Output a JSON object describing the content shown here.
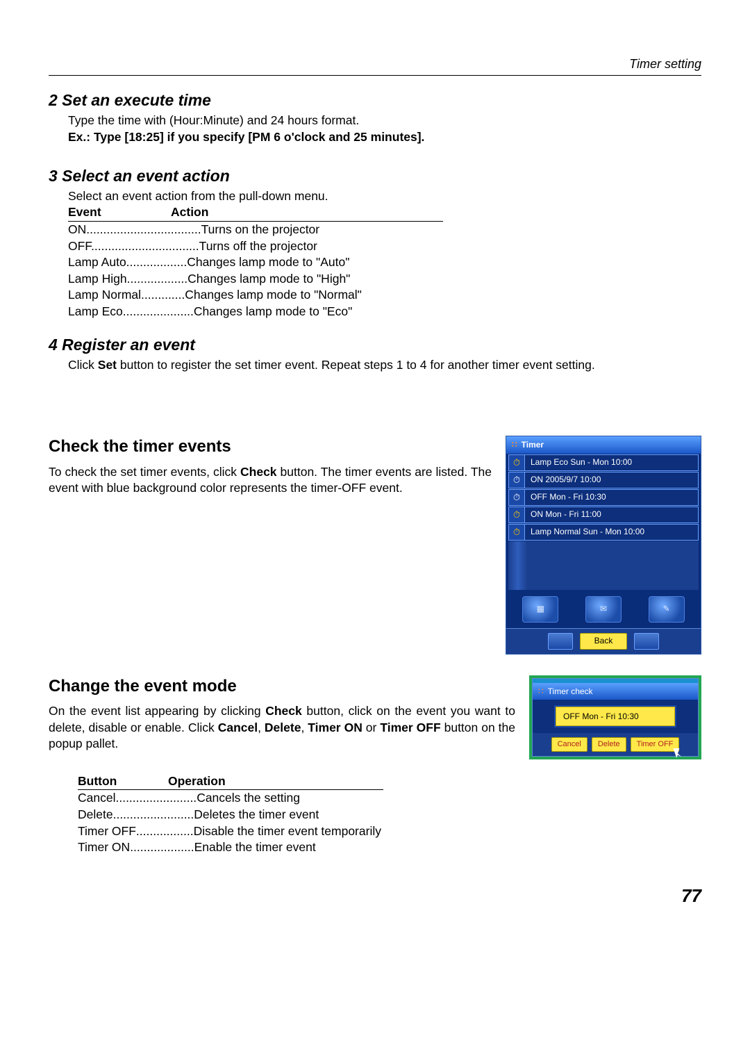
{
  "header": {
    "section": "Timer setting"
  },
  "step2": {
    "title": "2 Set an execute time",
    "line1": "Type the time with (Hour:Minute) and 24 hours format.",
    "line2": "Ex.: Type [18:25] if you specify [PM 6 o'clock and 25 minutes]."
  },
  "step3": {
    "title": "3 Select an event action",
    "intro": "Select an event action from the pull-down menu.",
    "col1": "Event",
    "col2": "Action",
    "rows": [
      {
        "ev": "ON",
        "dots": "..................................",
        "ac": "Turns on the projector"
      },
      {
        "ev": "OFF",
        "dots": "................................",
        "ac": "Turns off the projector"
      },
      {
        "ev": "Lamp Auto",
        "dots": "..................",
        "ac": "Changes lamp mode to \"Auto\""
      },
      {
        "ev": "Lamp High",
        "dots": "..................",
        "ac": "Changes lamp mode to \"High\""
      },
      {
        "ev": "Lamp Normal",
        "dots": ".............",
        "ac": "Changes lamp mode to \"Normal\""
      },
      {
        "ev": "Lamp Eco",
        "dots": ".....................",
        "ac": "Changes lamp mode to \"Eco\""
      }
    ]
  },
  "step4": {
    "title": "4 Register an event",
    "text_a": "Click ",
    "text_b": "Set",
    "text_c": " button to register the set timer event. Repeat steps 1 to 4 for another timer event setting."
  },
  "check": {
    "heading": "Check the timer events",
    "p_a": "To check the set timer events, click ",
    "p_b": "Check",
    "p_c": " button. The timer events are listed. The event with blue background color represents the timer-OFF event."
  },
  "timer_panel": {
    "title": "Timer",
    "rows": [
      {
        "icon": "⏱",
        "yellow": true,
        "text": "Lamp Eco Sun - Mon 10:00"
      },
      {
        "icon": "⏱",
        "yellow": false,
        "text": "ON 2005/9/7 10:00"
      },
      {
        "icon": "⏱",
        "yellow": false,
        "text": "OFF Mon - Fri 10:30"
      },
      {
        "icon": "⏱",
        "yellow": true,
        "text": "ON Mon - Fri 11:00"
      },
      {
        "icon": "⏱",
        "yellow": true,
        "text": "Lamp Normal Sun - Mon 10:00"
      }
    ],
    "btn_icons": [
      "▦",
      "✉",
      "✎"
    ],
    "back": "Back"
  },
  "change": {
    "heading": "Change the event mode",
    "p1a": "On the event list appearing by clicking ",
    "p1b": "Check",
    "p1c": " button, click on the event you want to delete, disable or enable. Click ",
    "p1d": "Cancel",
    "p1e": ", ",
    "p1f": "Delete",
    "p1g": ", ",
    "p1h": "Timer ON",
    "p1i": " or ",
    "p1j": "Timer OFF",
    "p1k": " button on the popup pallet."
  },
  "check_panel": {
    "title": "Timer check",
    "selected": "OFF Mon - Fri 10:30",
    "buttons": [
      "Cancel",
      "Delete",
      "Timer OFF"
    ]
  },
  "btable": {
    "h1": "Button",
    "h2": "Operation",
    "rows": [
      {
        "b": "Cancel",
        "d": "........................",
        "o": "Cancels the setting"
      },
      {
        "b": "Delete",
        "d": "........................",
        "o": "Deletes the timer event"
      },
      {
        "b": "Timer OFF",
        "d": ".................",
        "o": "Disable the timer event temporarily"
      },
      {
        "b": "Timer ON",
        "d": "...................",
        "o": "Enable the timer event"
      }
    ]
  },
  "page": "77"
}
